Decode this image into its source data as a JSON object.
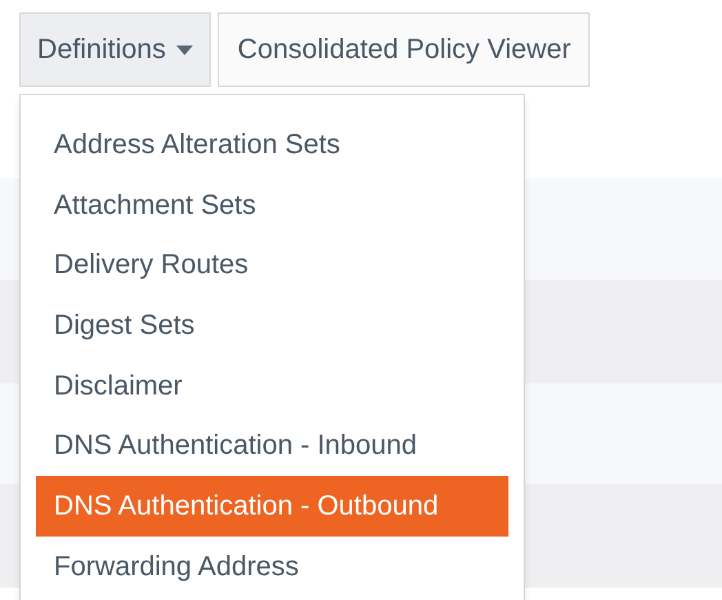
{
  "toolbar": [
    {
      "label": "Definitions",
      "kind": "dropdown",
      "expanded": true
    },
    {
      "label": "Consolidated Policy Viewer",
      "kind": "button"
    }
  ],
  "menu": {
    "items": [
      {
        "label": "Address Alteration Sets",
        "selected": false
      },
      {
        "label": "Attachment Sets",
        "selected": false
      },
      {
        "label": "Delivery Routes",
        "selected": false
      },
      {
        "label": "Digest Sets",
        "selected": false
      },
      {
        "label": "Disclaimer",
        "selected": false
      },
      {
        "label": "DNS Authentication - Inbound",
        "selected": false
      },
      {
        "label": "DNS Authentication - Outbound",
        "selected": true
      },
      {
        "label": "Forwarding Address",
        "selected": false
      }
    ]
  }
}
